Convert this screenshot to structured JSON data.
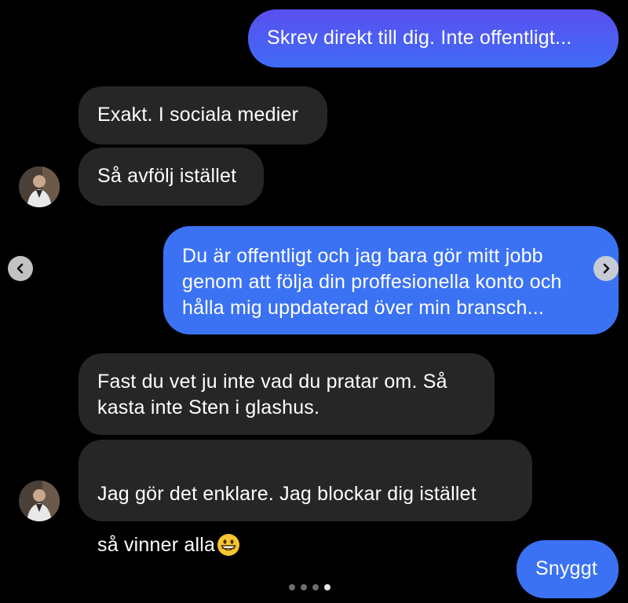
{
  "messages": [
    {
      "direction": "sent",
      "text": "Skrev direkt till dig. Inte offentligt..."
    },
    {
      "direction": "received",
      "text": "Exakt. I sociala medier"
    },
    {
      "direction": "received",
      "text": "Så avfölj istället"
    },
    {
      "direction": "sent",
      "text": "Du är offentligt och jag bara gör mitt jobb\ngenom att följa din proffesionella konto och\nhålla mig uppdaterad över min bransch..."
    },
    {
      "direction": "received",
      "text": "Fast du vet ju inte vad du pratar om. Så\nkasta inte Sten i glashus."
    },
    {
      "direction": "received",
      "text": "Jag gör det enklare. Jag blockar dig istället\nså vinner alla",
      "emoji": "grinning-face-emoji"
    },
    {
      "direction": "sent",
      "text": "Snyggt"
    }
  ],
  "carousel": {
    "prev_icon": "chevron-left-icon",
    "next_icon": "chevron-right-icon",
    "page_count": 4,
    "current_page": 4
  },
  "colors": {
    "background": "#000000",
    "sent_bubble": "#4a5ef2",
    "received_bubble": "#262626",
    "text": "#ffffff"
  }
}
